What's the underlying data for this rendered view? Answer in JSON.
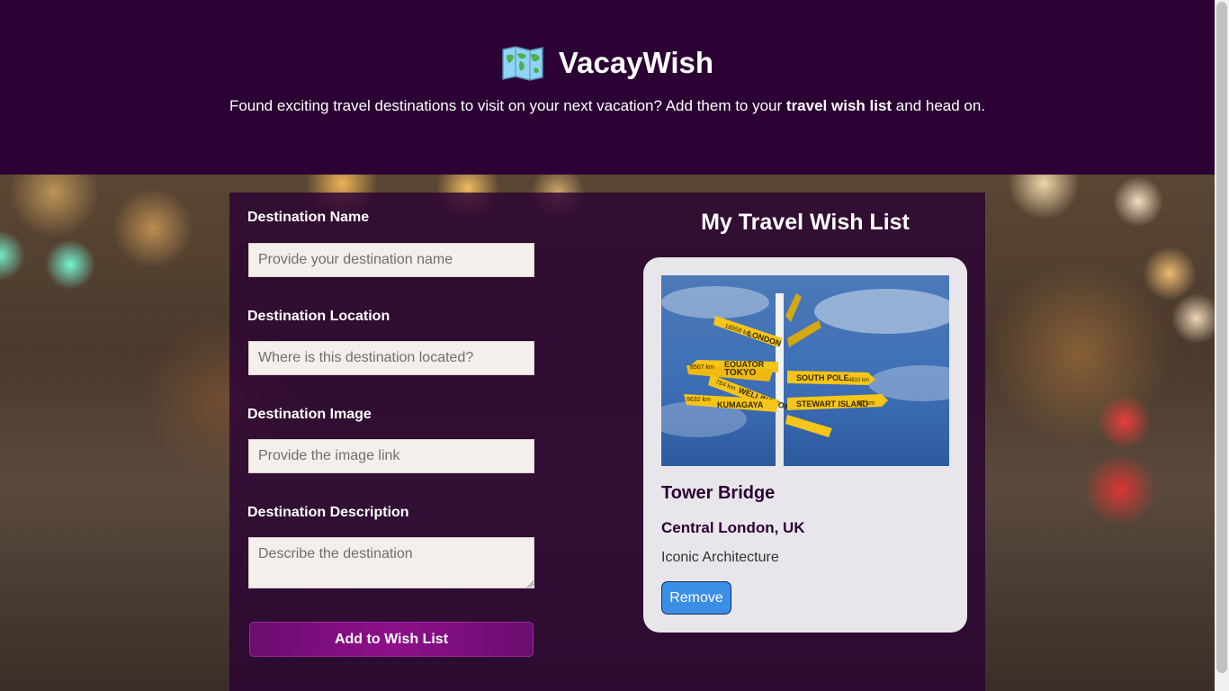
{
  "header": {
    "app_name": "VacayWish",
    "tagline_prefix": "Found exciting travel destinations to visit on your next vacation? Add them to your ",
    "tagline_bold": "travel wish list",
    "tagline_suffix": " and head on.",
    "logo_icon": "world-map-icon"
  },
  "form": {
    "name_label": "Destination Name",
    "name_placeholder": "Provide your destination name",
    "location_label": "Destination Location",
    "location_placeholder": "Where is this destination located?",
    "image_label": "Destination Image",
    "image_placeholder": "Provide the image link",
    "description_label": "Destination Description",
    "description_placeholder": "Describe the destination",
    "submit_label": "Add to Wish List"
  },
  "wishlist": {
    "title": "My Travel Wish List",
    "items": [
      {
        "name": "Tower Bridge",
        "location": "Central London, UK",
        "description": "Iconic Architecture",
        "remove_label": "Remove",
        "signs": [
          "LONDON",
          "EQUATOR",
          "TOKYO",
          "WELLINGTON",
          "KUMAGAYA",
          "SOUTH POLE",
          "STEWART ISLAND",
          "18958 km",
          "8567 km",
          "784 km",
          "9632 km",
          "4810 km",
          "35 km"
        ]
      }
    ]
  },
  "colors": {
    "header_bg": "#2b0233",
    "add_button": "#8e0f8a",
    "remove_button": "#3a8ee6"
  }
}
